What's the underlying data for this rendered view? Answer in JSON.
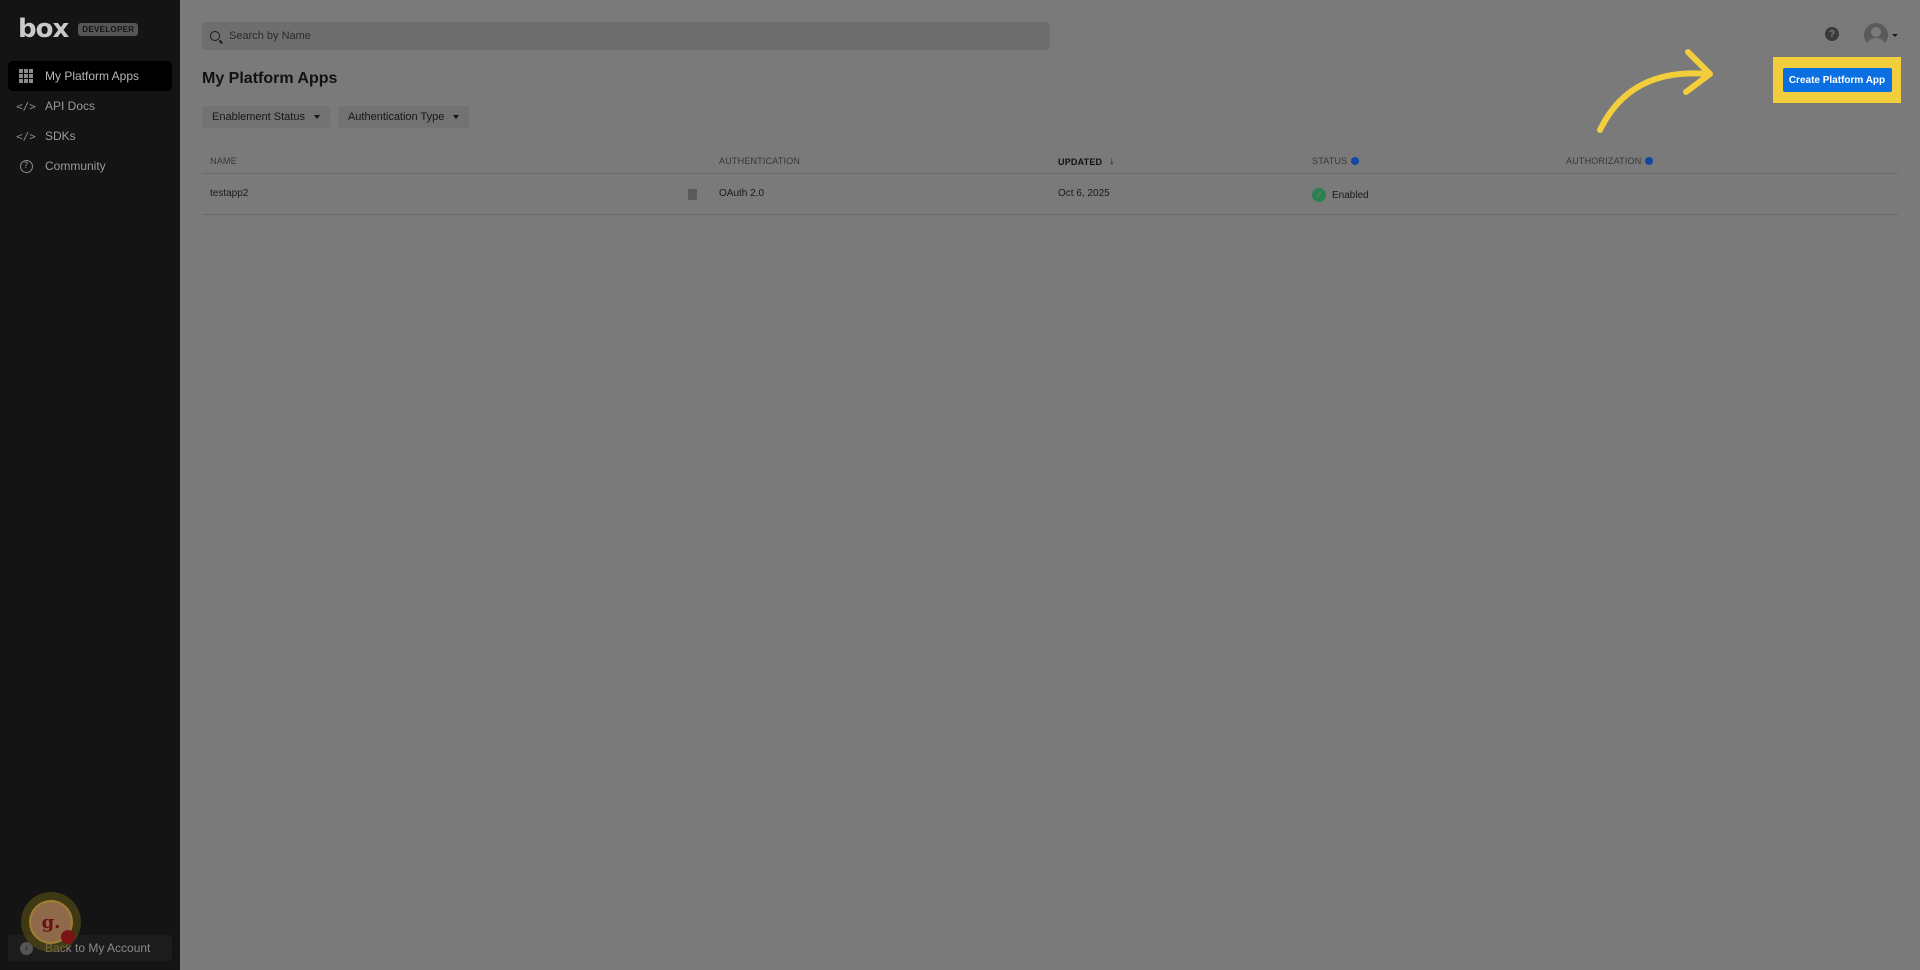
{
  "brand": {
    "logo": "box",
    "badge": "DEVELOPER"
  },
  "sidebar": {
    "items": [
      {
        "label": "My Platform Apps",
        "icon": "grid-icon",
        "active": true
      },
      {
        "label": "API Docs",
        "icon": "code-icon"
      },
      {
        "label": "SDKs",
        "icon": "code-icon"
      },
      {
        "label": "Community",
        "icon": "help-circle-icon"
      }
    ],
    "back_label": "Back to My Account",
    "widget_letter": "g."
  },
  "search": {
    "placeholder": "Search by Name"
  },
  "header": {
    "help": "?"
  },
  "page": {
    "title": "My Platform Apps",
    "create_label": "Create Platform App"
  },
  "filters": [
    {
      "label": "Enablement Status"
    },
    {
      "label": "Authentication Type"
    }
  ],
  "table": {
    "columns": [
      "NAME",
      "AUTHENTICATION",
      "UPDATED",
      "STATUS",
      "AUTHORIZATION"
    ],
    "rows": [
      {
        "name": "testapp2",
        "authentication": "OAuth 2.0",
        "updated": "Oct 6, 2025",
        "status": "Enabled",
        "authorization": ""
      }
    ]
  },
  "colors": {
    "accent": "#0a6fe0",
    "highlight": "#f2cd3c",
    "sidebar": "#141414",
    "overlay": "#7a7a7a"
  }
}
